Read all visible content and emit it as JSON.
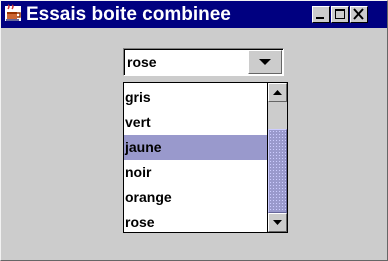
{
  "window": {
    "title": "Essais boite combinee",
    "icons": {
      "app": "coffee-cup-icon",
      "minimize": "minimize-icon",
      "maximize": "maximize-icon",
      "close": "close-icon"
    }
  },
  "combo": {
    "selected_value": "rose",
    "arrow_icon": "chevron-down-icon"
  },
  "dropdown": {
    "items": [
      "gris",
      "vert",
      "jaune",
      "noir",
      "orange",
      "rose"
    ],
    "highlighted": "jaune",
    "scroll": {
      "up_icon": "arrow-up-icon",
      "down_icon": "arrow-down-icon",
      "thumb_start_fraction": 0.24,
      "thumb_visible_fraction": 0.76
    }
  },
  "colors": {
    "titlebar": "#000080",
    "window": "#cccccc",
    "selection": "#9999cc"
  }
}
